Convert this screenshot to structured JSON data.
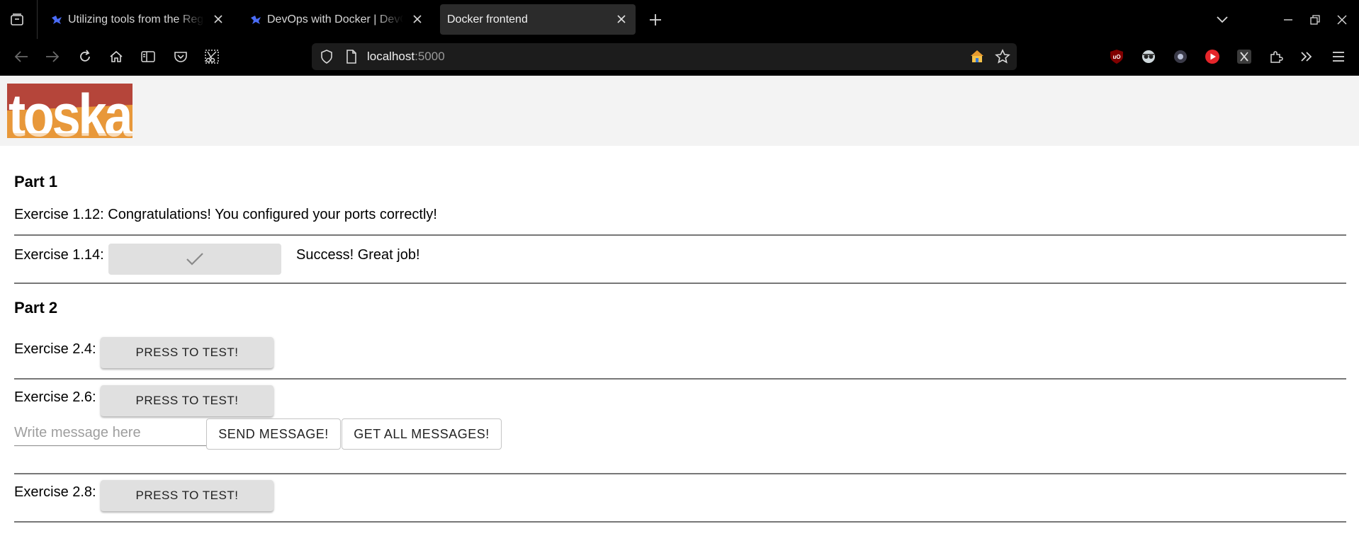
{
  "browser": {
    "tabs": [
      {
        "title": "Utilizing tools from the Regis",
        "active": false
      },
      {
        "title": "DevOps with Docker | DevOps",
        "active": false
      },
      {
        "title": "Docker frontend",
        "active": true
      }
    ],
    "url": {
      "host": "localhost",
      "port": ":5000"
    }
  },
  "page": {
    "logo": {
      "text": "toska",
      "colors": {
        "top": "#b5453a",
        "bottom": "#e8983a"
      }
    },
    "part1": {
      "heading": "Part 1",
      "ex112": "Exercise 1.12: Congratulations! You configured your ports correctly!",
      "ex114_label": "Exercise 1.14:",
      "ex114_status": "Success! Great job!"
    },
    "part2": {
      "heading": "Part 2",
      "ex24_label": "Exercise 2.4:",
      "ex26_label": "Exercise 2.6:",
      "ex28_label": "Exercise 2.8:",
      "test_button": "PRESS TO TEST!",
      "message_placeholder": "Write message here",
      "send_button": "SEND MESSAGE!",
      "get_button": "GET ALL MESSAGES!"
    }
  },
  "colors": {
    "chrome_bg": "#000000",
    "active_tab": "#2b2b2b",
    "header_bg": "#f3f3f3",
    "button_bg": "#e0e0e0"
  }
}
